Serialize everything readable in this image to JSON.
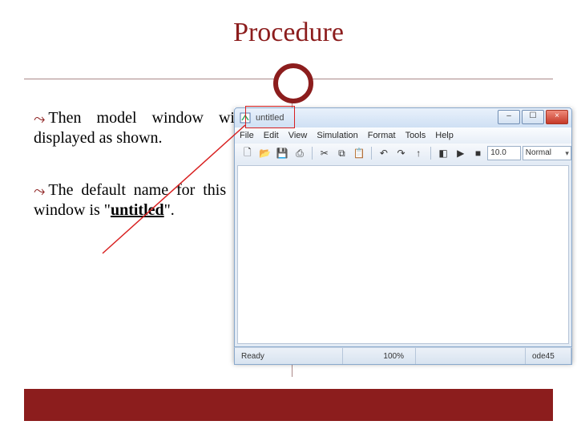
{
  "title": "Procedure",
  "bullets": [
    {
      "symbol": "⤳",
      "text": "Then model window will be displayed as shown."
    },
    {
      "symbol": "⤳",
      "text_pre": "The default name for this model window is \"",
      "text_bold": "untitled",
      "text_post": "\"."
    }
  ],
  "app": {
    "doc_title": "untitled",
    "menu": [
      "File",
      "Edit",
      "View",
      "Simulation",
      "Format",
      "Tools",
      "Help"
    ],
    "toolbar": {
      "new": "🗋",
      "open": "📂",
      "save": "💾",
      "print": "⎙",
      "cut": "✂",
      "copy": "⧉",
      "paste": "📋",
      "undo": "↶",
      "redo": "↷",
      "up": "↑",
      "cfg": "◧",
      "run": "▶",
      "stop": "■",
      "duration": "10.0",
      "mode": "Normal"
    },
    "status": {
      "ready": "Ready",
      "zoom": "100%",
      "solver": "ode45"
    },
    "winbtns": {
      "min": "–",
      "max": "☐",
      "close": "×"
    }
  }
}
